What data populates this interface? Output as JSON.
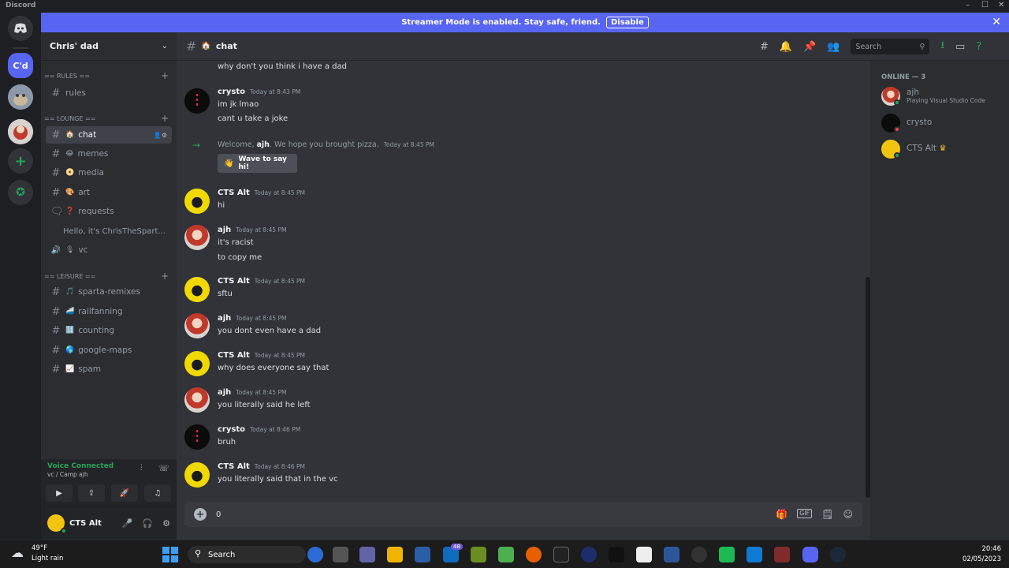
{
  "window": {
    "app_name": "Discord"
  },
  "banner": {
    "text": "Streamer Mode is enabled. Stay safe, friend.",
    "button": "Disable"
  },
  "rail": {
    "active_server_abbrev": "C'd"
  },
  "guild": {
    "name": "Chris' dad"
  },
  "sidebar": {
    "categories": [
      "== RULES ==",
      "== LOUNGE ==",
      "== LEISURE =="
    ],
    "channels": [
      {
        "name": "rules",
        "type": "text"
      },
      {
        "name": "chat",
        "type": "text",
        "active": true
      },
      {
        "name": "memes",
        "type": "text"
      },
      {
        "name": "media",
        "type": "text"
      },
      {
        "name": "art",
        "type": "text"
      },
      {
        "name": "requests",
        "type": "forum"
      },
      {
        "name": "Hello, it's ChrisTheSpart...",
        "type": "thread"
      },
      {
        "name": "vc",
        "type": "voice"
      },
      {
        "name": "sparta-remixes",
        "type": "text"
      },
      {
        "name": "railfanning",
        "type": "text"
      },
      {
        "name": "counting",
        "type": "text"
      },
      {
        "name": "google-maps",
        "type": "text"
      },
      {
        "name": "spam",
        "type": "text"
      }
    ]
  },
  "voice": {
    "status": "Voice Connected",
    "location": "vc / Camp ajh"
  },
  "user": {
    "name": "CTS Alt"
  },
  "chat": {
    "channel": "chat",
    "search_placeholder": "Search",
    "messages": [
      {
        "author": "",
        "time": "",
        "lines": [
          "why don't you think i have a dad"
        ]
      },
      {
        "author": "crysto",
        "time": "Today at 8:43 PM",
        "lines": [
          "im jk lmao",
          "cant u take a joke"
        ]
      },
      {
        "author": "CTS Alt",
        "time": "Today at 8:45 PM",
        "lines": [
          "hi"
        ]
      },
      {
        "author": "ajh",
        "time": "Today at 8:45 PM",
        "lines": [
          "it's racist",
          "to copy me"
        ]
      },
      {
        "author": "CTS Alt",
        "time": "Today at 8:45 PM",
        "lines": [
          "sftu"
        ]
      },
      {
        "author": "ajh",
        "time": "Today at 8:45 PM",
        "lines": [
          "you dont even have a dad"
        ]
      },
      {
        "author": "CTS Alt",
        "time": "Today at 8:45 PM",
        "lines": [
          "why does everyone say that"
        ]
      },
      {
        "author": "ajh",
        "time": "Today at 8:45 PM",
        "lines": [
          "you literally said he left"
        ]
      },
      {
        "author": "crysto",
        "time": "Today at 8:46 PM",
        "lines": [
          "bruh"
        ]
      },
      {
        "author": "CTS Alt",
        "time": "Today at 8:46 PM",
        "lines": [
          "you literally said that in the vc"
        ]
      }
    ],
    "welcome": {
      "prefix": "Welcome,",
      "user": "ajh",
      "suffix": ". We hope you brought pizza.",
      "time": "Today at 8:45 PM",
      "button": "Wave to say hi!"
    },
    "composer_value": "0"
  },
  "members": {
    "group": "ONLINE — 3",
    "list": [
      {
        "name": "ajh",
        "activity": "Playing Visual Studio Code"
      },
      {
        "name": "crysto",
        "activity": ""
      },
      {
        "name": "CTS Alt",
        "activity": ""
      }
    ]
  },
  "taskbar": {
    "weather_temp": "49°F",
    "weather_desc": "Light rain",
    "search": "Search",
    "badge": "48",
    "time": "20:46",
    "date": "02/05/2023"
  },
  "colors": {
    "accent": "#5865f2",
    "online": "#23a55a",
    "dnd": "#f23f43"
  }
}
